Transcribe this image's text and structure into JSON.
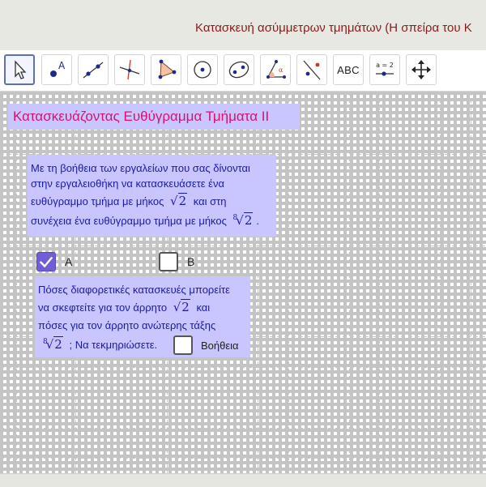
{
  "window": {
    "title": "Κατασκευή ασύμμετρων τμημάτων (Η σπείρα του Κ"
  },
  "toolbar": {
    "tools": [
      {
        "name": "move-tool"
      },
      {
        "name": "point-tool",
        "label": "A"
      },
      {
        "name": "line-tool"
      },
      {
        "name": "perpendicular-line-tool"
      },
      {
        "name": "polygon-tool"
      },
      {
        "name": "circle-tool"
      },
      {
        "name": "conic-tool"
      },
      {
        "name": "angle-tool",
        "label": "α"
      },
      {
        "name": "reflect-tool"
      },
      {
        "name": "text-tool",
        "label": "ABC"
      },
      {
        "name": "slider-tool",
        "label": "a = 2"
      },
      {
        "name": "move-graphics-view-tool"
      }
    ],
    "selected": 0
  },
  "heading": {
    "text": "Κατασκευάζοντας Ευθύγραμμα Τμήματα ΙΙ"
  },
  "instructions": {
    "line1": "Με τη βοήθεια των εργαλείων που σας δίνονται",
    "line2": "στην εργαλειοθήκη να κατασκευάσετε ένα",
    "line3_pre": "ευθύγραμμο τμήμα με μήκος",
    "line3_root": "2",
    "line3_post": "και στη",
    "line4_pre": "συνέχεια ένα ευθύγραμμο τμήμα με μήκος",
    "line4_index": "8",
    "line4_root": "2",
    "line4_post": "."
  },
  "checkboxes": {
    "a": {
      "label": "A",
      "checked": true
    },
    "b": {
      "label": "B",
      "checked": false
    },
    "help": {
      "label": "Βοήθεια",
      "checked": false
    }
  },
  "question": {
    "line1": "Πόσες διαφορετικές κατασκευές μπορείτε",
    "line2_pre": "να σκεφτείτε για τον άρρητο",
    "line2_root": "2",
    "line2_post": "και",
    "line3": "πόσες για τον άρρητο ανώτερης τάξης",
    "line4_index": "8",
    "line4_root": "2",
    "line4_post": "; Να τεκμηριώσετε."
  },
  "colors": {
    "title": "#8b1a1a",
    "heading": "#d6136b",
    "textbox_bg": "#c9c6ff",
    "text": "#1a1aa8",
    "checkbox_on": "#6f5ed6"
  }
}
